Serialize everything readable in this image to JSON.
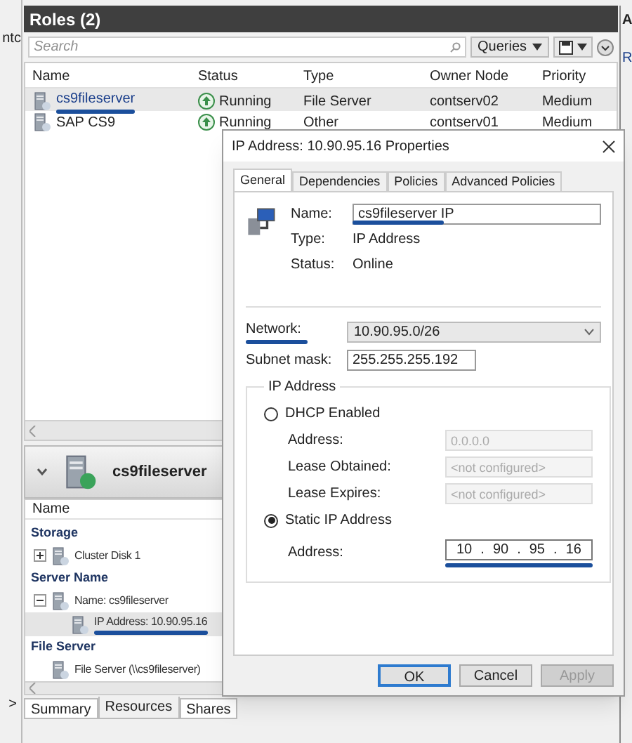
{
  "left_strip": {
    "text": "ntc",
    "arrow": ">"
  },
  "roles": {
    "title": "Roles (2)",
    "search": {
      "placeholder": "Search"
    },
    "queries": "Queries",
    "columns": [
      "Name",
      "Status",
      "Type",
      "Owner Node",
      "Priority"
    ],
    "rows": [
      {
        "name": "cs9fileserver",
        "status": "Running",
        "type": "File Server",
        "owner": "contserv02",
        "priority": "Medium",
        "selected": true,
        "underlined": true
      },
      {
        "name": "SAP CS9",
        "status": "Running",
        "type": "Other",
        "owner": "contserv01",
        "priority": "Medium",
        "selected": false,
        "underlined": false
      }
    ]
  },
  "detail": {
    "title": "cs9fileserver",
    "column": "Name",
    "groups": [
      {
        "label": "Storage",
        "items": [
          {
            "label": "Cluster Disk 1",
            "expanded": false,
            "selected": false,
            "underlined": false
          }
        ]
      },
      {
        "label": "Server Name",
        "items": [
          {
            "label": "Name: cs9fileserver",
            "expanded": true,
            "selected": false,
            "underlined": false,
            "children": [
              {
                "label": "IP Address: 10.90.95.16",
                "selected": true,
                "underlined": true
              }
            ]
          }
        ]
      },
      {
        "label": "File Server",
        "items": [
          {
            "label": "File Server (\\\\cs9fileserver)",
            "selected": false,
            "underlined": false
          }
        ]
      }
    ],
    "tabs": [
      {
        "label": "Summary",
        "selected": false
      },
      {
        "label": "Resources",
        "selected": true
      },
      {
        "label": "Shares",
        "selected": false
      }
    ]
  },
  "right_strip": {
    "texts": [
      "A",
      "R"
    ]
  },
  "dialog": {
    "title": "IP Address: 10.90.95.16 Properties",
    "tabs": [
      {
        "label": "General",
        "selected": true
      },
      {
        "label": "Dependencies",
        "selected": false
      },
      {
        "label": "Policies",
        "selected": false
      },
      {
        "label": "Advanced Policies",
        "selected": false
      }
    ],
    "name": {
      "label": "Name:",
      "value": "cs9fileserver IP",
      "underlined": true
    },
    "type": {
      "label": "Type:",
      "value": "IP Address"
    },
    "status": {
      "label": "Status:",
      "value": "Online"
    },
    "network": {
      "label": "Network:",
      "value": "10.90.95.0/26",
      "underlined": true
    },
    "subnet": {
      "label": "Subnet mask:",
      "value": "255.255.255.192"
    },
    "group": {
      "title": "IP Address",
      "options": [
        {
          "label": "DHCP Enabled",
          "selected": false,
          "fields": [
            {
              "label": "Address:",
              "value": "0.0.0.0",
              "disabled": true
            },
            {
              "label": "Lease Obtained:",
              "value": "<not configured>",
              "disabled": true
            },
            {
              "label": "Lease Expires:",
              "value": "<not configured>",
              "disabled": true
            }
          ]
        },
        {
          "label": "Static IP Address",
          "selected": true,
          "address": {
            "label": "Address:",
            "octets": [
              "10",
              "90",
              "95",
              "16"
            ],
            "separator": ".",
            "underlined": true
          }
        }
      ]
    },
    "buttons": [
      {
        "label": "OK",
        "default": true,
        "disabled": false
      },
      {
        "label": "Cancel",
        "default": false,
        "disabled": false
      },
      {
        "label": "Apply",
        "default": false,
        "disabled": true
      }
    ]
  }
}
